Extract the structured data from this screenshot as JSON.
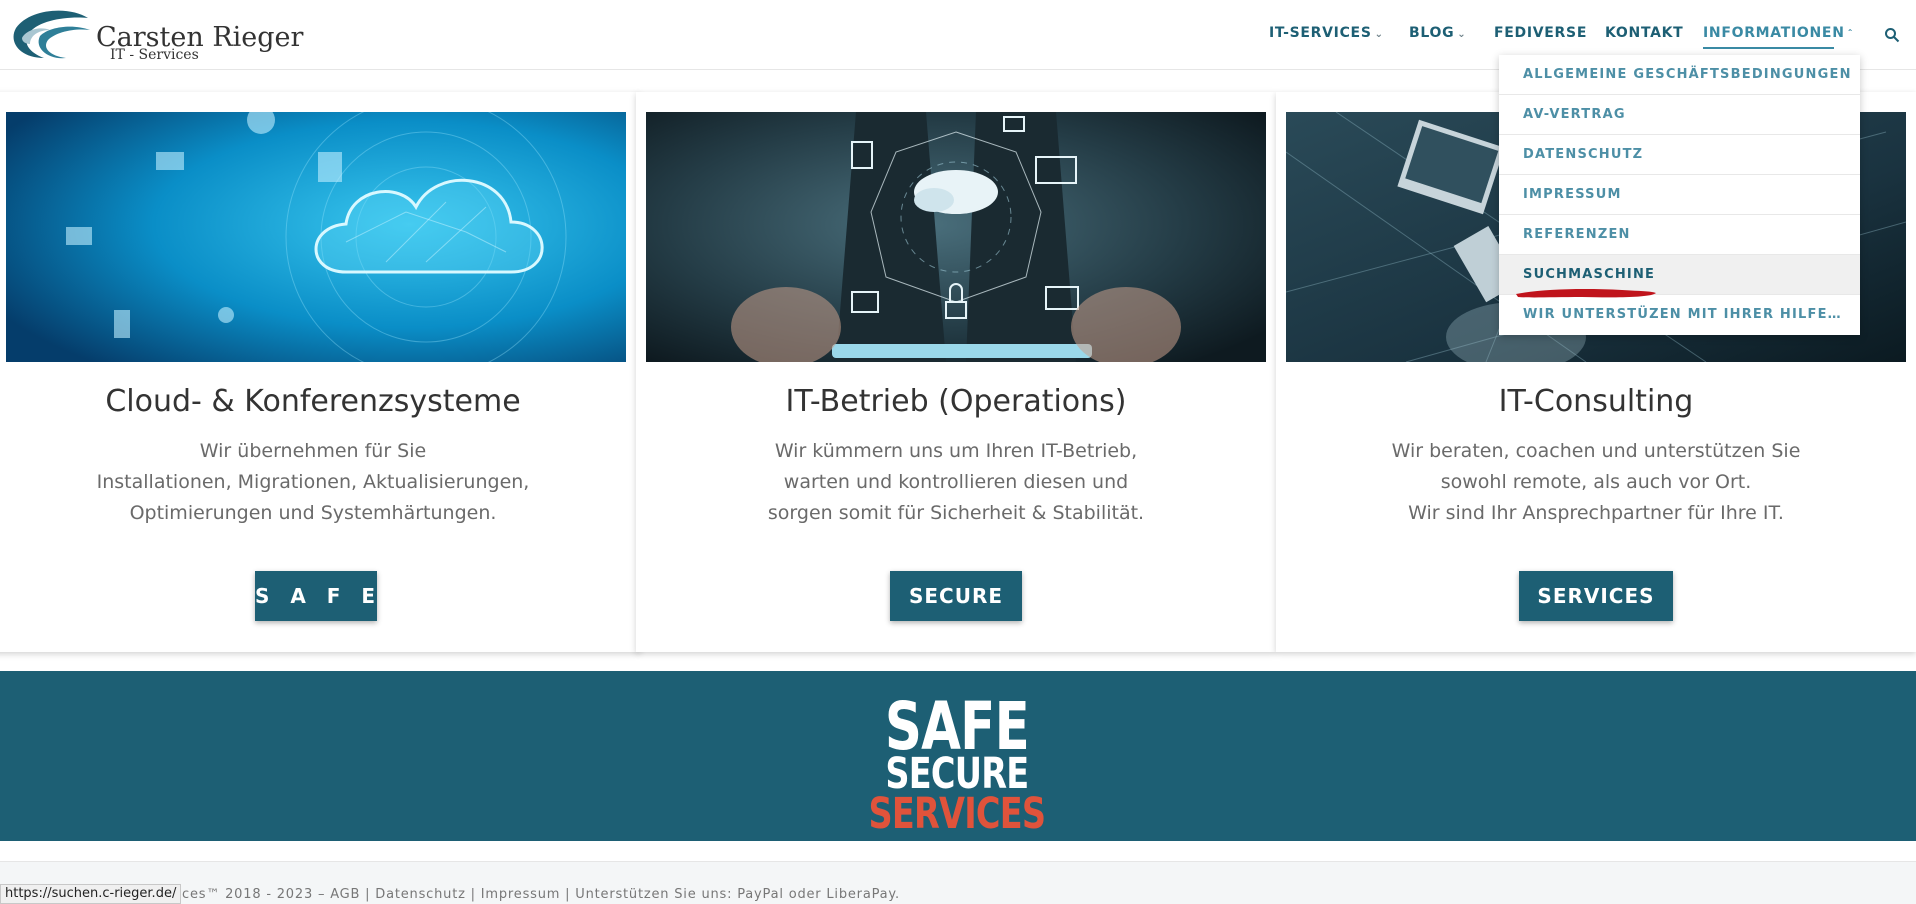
{
  "header": {
    "logo_title": "Carsten Rieger",
    "logo_subtitle": "IT - Services",
    "nav": [
      {
        "label": "IT-SERVICES",
        "has_dropdown": true
      },
      {
        "label": "BLOG",
        "has_dropdown": true
      },
      {
        "label": "FEDIVERSE",
        "has_dropdown": false
      },
      {
        "label": "KONTAKT",
        "has_dropdown": false
      },
      {
        "label": "INFORMATIONEN",
        "has_dropdown": true,
        "expanded": true
      }
    ],
    "search_icon": "search-icon"
  },
  "dropdown": {
    "items": [
      {
        "label": "ALLGEMEINE GESCHÄFTSBEDINGUNGEN"
      },
      {
        "label": "AV-VERTRAG"
      },
      {
        "label": "DATENSCHUTZ"
      },
      {
        "label": "IMPRESSUM"
      },
      {
        "label": "REFERENZEN"
      },
      {
        "label": "SUCHMASCHINE",
        "hovered": true
      },
      {
        "label": "WIR UNTERSTÜZEN MIT IHRER HILFE…"
      }
    ]
  },
  "cards": [
    {
      "title": "Cloud- & Konferenzsysteme",
      "text": [
        "Wir übernehmen für Sie",
        "Installationen, Migrationen, Aktualisierungen,",
        "Optimierungen und Systemhärtungen."
      ],
      "button": "S A F E"
    },
    {
      "title": "IT-Betrieb (Operations)",
      "text": [
        "Wir kümmern uns um Ihren IT-Betrieb,",
        "warten und kontrollieren diesen und",
        "sorgen somit für Sicherheit & Stabilität."
      ],
      "button": "SECURE"
    },
    {
      "title": "IT-Consulting",
      "text": [
        "Wir beraten, coachen und unterstützen Sie",
        "sowohl remote, als auch vor Ort.",
        "Wir sind Ihr Ansprechpartner für Ihre IT."
      ],
      "button": "SERVICES"
    }
  ],
  "banner": {
    "line1": "SAFE",
    "line2": "SECURE",
    "line3": "SERVICES"
  },
  "footer": {
    "text": "rvices™ 2018 - 2023 – AGB | Datenschutz | Impressum | Unterstützen Sie uns: PayPal oder LiberaPay."
  },
  "status_url": "https://suchen.c-rieger.de/",
  "colors": {
    "brand": "#1d5f74",
    "nav_active": "#3a8aa4",
    "accent_red": "#e0533b",
    "annotation_red": "#c0141c"
  }
}
